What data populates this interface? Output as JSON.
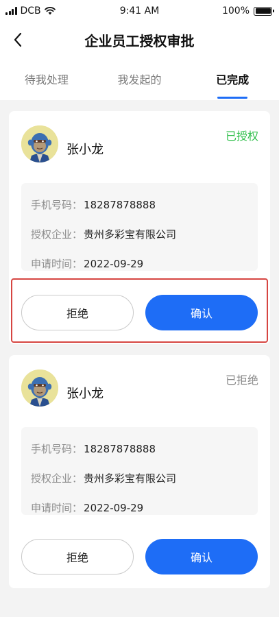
{
  "status_bar": {
    "carrier": "DCB",
    "time": "9:41 AM",
    "battery": "100%"
  },
  "nav": {
    "title": "企业员工授权审批"
  },
  "tabs": [
    {
      "label": "待我处理",
      "active": false
    },
    {
      "label": "我发起的",
      "active": false
    },
    {
      "label": "已完成",
      "active": true
    }
  ],
  "labels": {
    "phone": "手机号码",
    "company": "授权企业",
    "time": "申请时间",
    "separator": "："
  },
  "cards": [
    {
      "name": "张小龙",
      "status": "已授权",
      "phone": "18287878888",
      "company": "贵州多彩宝有限公司",
      "date": "2022-09-29",
      "reject_label": "拒绝",
      "confirm_label": "确认",
      "highlighted": true
    },
    {
      "name": "张小龙",
      "status": "已拒绝",
      "phone": "18287878888",
      "company": "贵州多彩宝有限公司",
      "date": "2022-09-29",
      "reject_label": "拒绝",
      "confirm_label": "确认",
      "highlighted": false
    }
  ],
  "colors": {
    "accent": "#1e6df6",
    "authorized": "#2fbf4a",
    "rejected": "#8a8a8a",
    "highlight": "#d64541"
  },
  "icons": [
    "signal-icon",
    "wifi-icon",
    "battery-icon",
    "back-arrow-icon",
    "avatar-ape-icon"
  ]
}
